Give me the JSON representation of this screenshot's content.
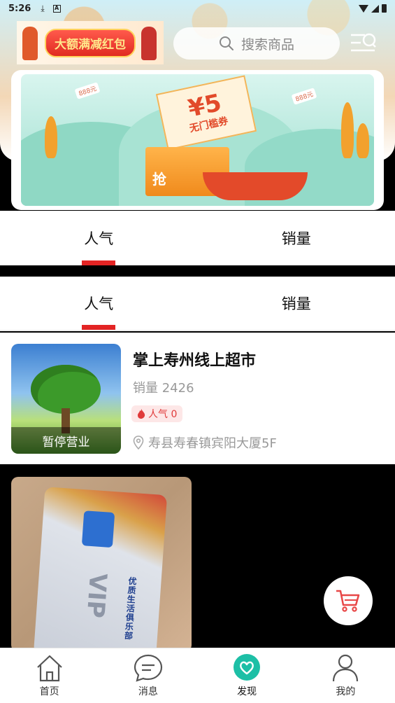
{
  "status_bar": {
    "time": "5:26"
  },
  "header": {
    "promo_logo_text": "大额满减红包",
    "search_placeholder": "搜索商品"
  },
  "banner": {
    "coupon_value": "¥5",
    "coupon_text": "无门槛券",
    "grab_text": "抢",
    "badge_text": "888元"
  },
  "tabs_top": [
    {
      "label": "人气",
      "active": true
    },
    {
      "label": "销量",
      "active": false
    }
  ],
  "tabs_sticky": [
    {
      "label": "人气",
      "active": true
    },
    {
      "label": "销量",
      "active": false
    }
  ],
  "store": {
    "name": "掌上寿州线上超市",
    "sales": "销量 2426",
    "popularity": "人气 0",
    "address": "寿县寿春镇宾阳大厦5F",
    "status": "暂停营业"
  },
  "card2": {
    "vip_text": "VIP",
    "side_text": "优质生活俱乐部"
  },
  "bottom_nav": [
    {
      "label": "首页",
      "icon": "home-icon"
    },
    {
      "label": "消息",
      "icon": "message-icon"
    },
    {
      "label": "发现",
      "icon": "discover-icon",
      "active": true
    },
    {
      "label": "我的",
      "icon": "profile-icon"
    }
  ],
  "colors": {
    "accent": "#e32424",
    "active_nav": "#1dbfa6"
  }
}
